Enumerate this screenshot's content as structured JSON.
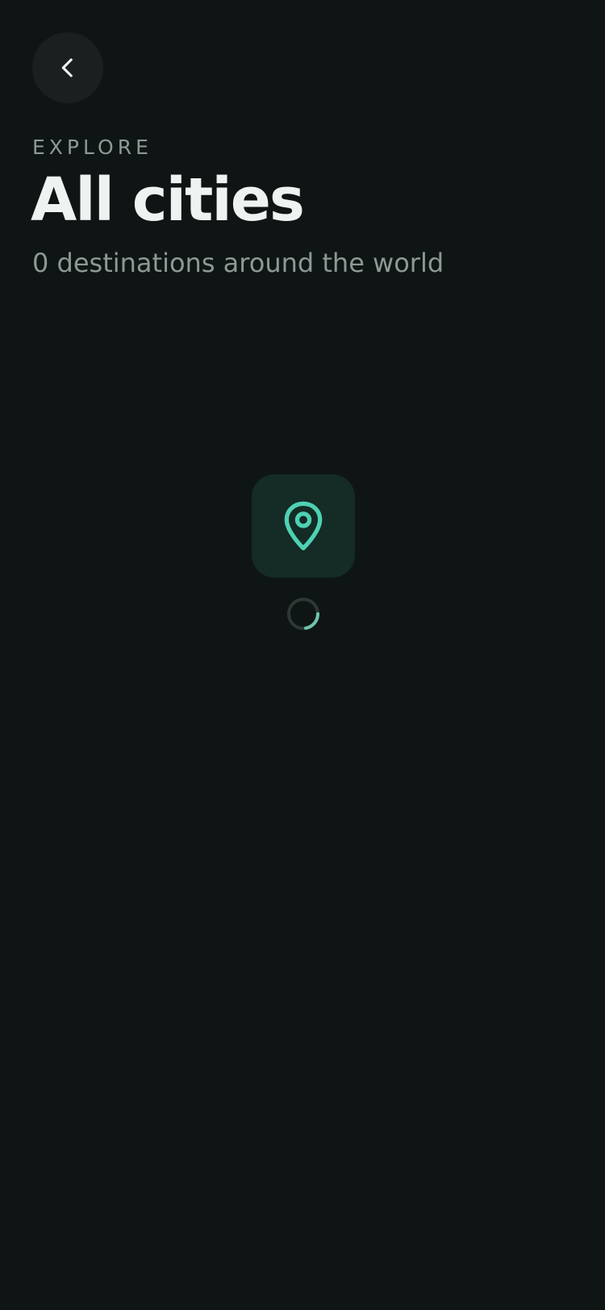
{
  "header": {
    "back_icon": "chevron-left-icon",
    "eyebrow": "EXPLORE",
    "title": "All cities",
    "subtitle": "0 destinations around the world"
  },
  "empty_state": {
    "icon": "map-pin-icon",
    "status": "loading"
  },
  "colors": {
    "background": "#0f1514",
    "accent": "#4fd1b3",
    "icon_tile": "#142b26",
    "back_button": "#1a201f",
    "muted_text": "#8e9894",
    "primary_text": "#eef3f1"
  }
}
